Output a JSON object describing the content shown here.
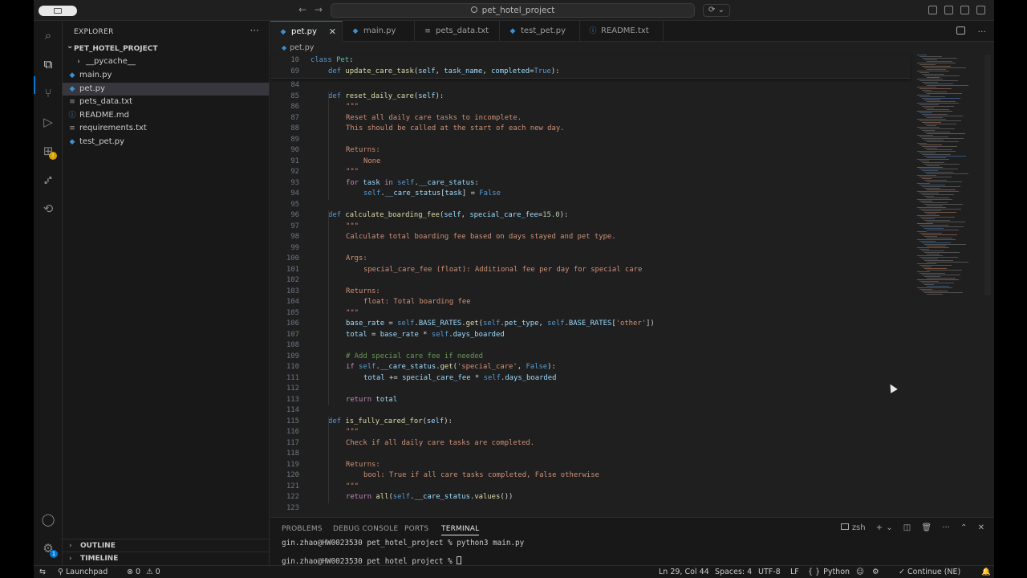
{
  "titlebar": {
    "search_text": "pet_hotel_project"
  },
  "sidebar": {
    "title": "EXPLORER",
    "project": "PET_HOTEL_PROJECT",
    "items": [
      {
        "label": "__pycache__",
        "icon": "›"
      },
      {
        "label": "main.py",
        "icon": "◆"
      },
      {
        "label": "pet.py",
        "icon": "◆"
      },
      {
        "label": "pets_data.txt",
        "icon": "≡"
      },
      {
        "label": "README.md",
        "icon": "ⓘ"
      },
      {
        "label": "requirements.txt",
        "icon": "≡"
      },
      {
        "label": "test_pet.py",
        "icon": "◆"
      }
    ],
    "outline": "OUTLINE",
    "timeline": "TIMELINE"
  },
  "tabs": [
    {
      "label": "pet.py",
      "icon": "◆"
    },
    {
      "label": "main.py",
      "icon": "◆"
    },
    {
      "label": "pets_data.txt",
      "icon": "≡"
    },
    {
      "label": "test_pet.py",
      "icon": "◆"
    },
    {
      "label": "README.txt",
      "icon": "ⓘ"
    }
  ],
  "breadcrumb": "pet.py",
  "sticky": [
    {
      "n": "10",
      "indent": 0,
      "tokens": [
        [
          "kw",
          "class "
        ],
        [
          "cls",
          "Pet"
        ],
        [
          "tx",
          ":"
        ]
      ]
    },
    {
      "n": "69",
      "indent": 1,
      "tokens": [
        [
          "kw",
          "def "
        ],
        [
          "fn",
          "update_care_task"
        ],
        [
          "tx",
          "("
        ],
        [
          "var",
          "self"
        ],
        [
          "tx",
          ", "
        ],
        [
          "var",
          "task_name"
        ],
        [
          "tx",
          ", "
        ],
        [
          "var",
          "completed"
        ],
        [
          "op",
          "="
        ],
        [
          "kw",
          "True"
        ],
        [
          "tx",
          "):"
        ]
      ]
    }
  ],
  "code": [
    {
      "n": "84",
      "indent": 0,
      "tokens": []
    },
    {
      "n": "85",
      "indent": 1,
      "tokens": [
        [
          "kw",
          "def "
        ],
        [
          "fn",
          "reset_daily_care"
        ],
        [
          "tx",
          "("
        ],
        [
          "var",
          "self"
        ],
        [
          "tx",
          "):"
        ]
      ]
    },
    {
      "n": "86",
      "indent": 2,
      "tokens": [
        [
          "doc",
          "\"\"\""
        ]
      ]
    },
    {
      "n": "87",
      "indent": 2,
      "tokens": [
        [
          "doc",
          "Reset all daily care tasks to incomplete."
        ]
      ]
    },
    {
      "n": "88",
      "indent": 2,
      "tokens": [
        [
          "doc",
          "This should be called at the start of each new day."
        ]
      ]
    },
    {
      "n": "89",
      "indent": 0,
      "tokens": []
    },
    {
      "n": "90",
      "indent": 2,
      "tokens": [
        [
          "doc",
          "Returns:"
        ]
      ]
    },
    {
      "n": "91",
      "indent": 3,
      "tokens": [
        [
          "doc",
          "None"
        ]
      ]
    },
    {
      "n": "92",
      "indent": 2,
      "tokens": [
        [
          "doc",
          "\"\"\""
        ]
      ]
    },
    {
      "n": "93",
      "indent": 2,
      "tokens": [
        [
          "kw2",
          "for "
        ],
        [
          "var",
          "task"
        ],
        [
          "kw2",
          " in "
        ],
        [
          "self",
          "self"
        ],
        [
          "tx",
          "."
        ],
        [
          "var",
          "__care_status"
        ],
        [
          "tx",
          ":"
        ]
      ]
    },
    {
      "n": "94",
      "indent": 3,
      "tokens": [
        [
          "self",
          "self"
        ],
        [
          "tx",
          "."
        ],
        [
          "var",
          "__care_status"
        ],
        [
          "tx",
          "["
        ],
        [
          "var",
          "task"
        ],
        [
          "tx",
          "] = "
        ],
        [
          "kw",
          "False"
        ]
      ]
    },
    {
      "n": "95",
      "indent": 0,
      "tokens": []
    },
    {
      "n": "96",
      "indent": 1,
      "tokens": [
        [
          "kw",
          "def "
        ],
        [
          "fn",
          "calculate_boarding_fee"
        ],
        [
          "tx",
          "("
        ],
        [
          "var",
          "self"
        ],
        [
          "tx",
          ", "
        ],
        [
          "var",
          "special_care_fee"
        ],
        [
          "op",
          "="
        ],
        [
          "num",
          "15.0"
        ],
        [
          "tx",
          "):"
        ]
      ]
    },
    {
      "n": "97",
      "indent": 2,
      "tokens": [
        [
          "doc",
          "\"\"\""
        ]
      ]
    },
    {
      "n": "98",
      "indent": 2,
      "tokens": [
        [
          "doc",
          "Calculate total boarding fee based on days stayed and pet type."
        ]
      ]
    },
    {
      "n": "99",
      "indent": 0,
      "tokens": []
    },
    {
      "n": "100",
      "indent": 2,
      "tokens": [
        [
          "doc",
          "Args:"
        ]
      ]
    },
    {
      "n": "101",
      "indent": 3,
      "tokens": [
        [
          "doc",
          "special_care_fee (float): Additional fee per day for special care"
        ]
      ]
    },
    {
      "n": "102",
      "indent": 0,
      "tokens": []
    },
    {
      "n": "103",
      "indent": 2,
      "tokens": [
        [
          "doc",
          "Returns:"
        ]
      ]
    },
    {
      "n": "104",
      "indent": 3,
      "tokens": [
        [
          "doc",
          "float: Total boarding fee"
        ]
      ]
    },
    {
      "n": "105",
      "indent": 2,
      "tokens": [
        [
          "doc",
          "\"\"\""
        ]
      ]
    },
    {
      "n": "106",
      "indent": 2,
      "tokens": [
        [
          "var",
          "base_rate"
        ],
        [
          "tx",
          " = "
        ],
        [
          "self",
          "self"
        ],
        [
          "tx",
          "."
        ],
        [
          "var",
          "BASE_RATES"
        ],
        [
          "tx",
          "."
        ],
        [
          "fn",
          "get"
        ],
        [
          "tx",
          "("
        ],
        [
          "self",
          "self"
        ],
        [
          "tx",
          "."
        ],
        [
          "var",
          "pet_type"
        ],
        [
          "tx",
          ", "
        ],
        [
          "self",
          "self"
        ],
        [
          "tx",
          "."
        ],
        [
          "var",
          "BASE_RATES"
        ],
        [
          "tx",
          "["
        ],
        [
          "str",
          "'other'"
        ],
        [
          "tx",
          "])"
        ]
      ]
    },
    {
      "n": "107",
      "indent": 2,
      "tokens": [
        [
          "var",
          "total"
        ],
        [
          "tx",
          " = "
        ],
        [
          "var",
          "base_rate"
        ],
        [
          "tx",
          " * "
        ],
        [
          "self",
          "self"
        ],
        [
          "tx",
          "."
        ],
        [
          "var",
          "days_boarded"
        ]
      ]
    },
    {
      "n": "108",
      "indent": 0,
      "tokens": []
    },
    {
      "n": "109",
      "indent": 2,
      "tokens": [
        [
          "cm",
          "# Add special care fee if needed"
        ]
      ]
    },
    {
      "n": "110",
      "indent": 2,
      "tokens": [
        [
          "kw2",
          "if "
        ],
        [
          "self",
          "self"
        ],
        [
          "tx",
          "."
        ],
        [
          "var",
          "__care_status"
        ],
        [
          "tx",
          "."
        ],
        [
          "fn",
          "get"
        ],
        [
          "tx",
          "("
        ],
        [
          "str",
          "'special_care'"
        ],
        [
          "tx",
          ", "
        ],
        [
          "kw",
          "False"
        ],
        [
          "tx",
          "):"
        ]
      ]
    },
    {
      "n": "111",
      "indent": 3,
      "tokens": [
        [
          "var",
          "total"
        ],
        [
          "tx",
          " += "
        ],
        [
          "var",
          "special_care_fee"
        ],
        [
          "tx",
          " * "
        ],
        [
          "self",
          "self"
        ],
        [
          "tx",
          "."
        ],
        [
          "var",
          "days_boarded"
        ]
      ]
    },
    {
      "n": "112",
      "indent": 0,
      "tokens": []
    },
    {
      "n": "113",
      "indent": 2,
      "tokens": [
        [
          "kw2",
          "return "
        ],
        [
          "var",
          "total"
        ]
      ]
    },
    {
      "n": "114",
      "indent": 0,
      "tokens": []
    },
    {
      "n": "115",
      "indent": 1,
      "tokens": [
        [
          "kw",
          "def "
        ],
        [
          "fn",
          "is_fully_cared_for"
        ],
        [
          "tx",
          "("
        ],
        [
          "var",
          "self"
        ],
        [
          "tx",
          "):"
        ]
      ]
    },
    {
      "n": "116",
      "indent": 2,
      "tokens": [
        [
          "doc",
          "\"\"\""
        ]
      ]
    },
    {
      "n": "117",
      "indent": 2,
      "tokens": [
        [
          "doc",
          "Check if all daily care tasks are completed."
        ]
      ]
    },
    {
      "n": "118",
      "indent": 0,
      "tokens": []
    },
    {
      "n": "119",
      "indent": 2,
      "tokens": [
        [
          "doc",
          "Returns:"
        ]
      ]
    },
    {
      "n": "120",
      "indent": 3,
      "tokens": [
        [
          "doc",
          "bool: True if all care tasks completed, False otherwise"
        ]
      ]
    },
    {
      "n": "121",
      "indent": 2,
      "tokens": [
        [
          "doc",
          "\"\"\""
        ]
      ]
    },
    {
      "n": "122",
      "indent": 2,
      "tokens": [
        [
          "kw2",
          "return "
        ],
        [
          "fn",
          "all"
        ],
        [
          "tx",
          "("
        ],
        [
          "self",
          "self"
        ],
        [
          "tx",
          "."
        ],
        [
          "var",
          "__care_status"
        ],
        [
          "tx",
          "."
        ],
        [
          "fn",
          "values"
        ],
        [
          "tx",
          "())"
        ]
      ]
    },
    {
      "n": "123",
      "indent": 0,
      "tokens": []
    }
  ],
  "panel": {
    "tabs": [
      "PROBLEMS",
      "DEBUG CONSOLE",
      "PORTS",
      "TERMINAL"
    ],
    "shell": "zsh",
    "terminal_lines": [
      "gin.zhao@HW0023530 pet_hotel_project % python3 main.py",
      "gin.zhao@HW0023530 pet_hotel_project % "
    ]
  },
  "status": {
    "launchpad": "Launchpad",
    "errors": "0",
    "warnings": "0",
    "position": "Ln 29, Col 44",
    "spaces": "Spaces: 4",
    "encoding": "UTF-8",
    "eol": "LF",
    "language": "Python",
    "language_braces": "{ }",
    "continue": "Continue (NE)"
  },
  "colors": {
    "accent": "#0078d4",
    "editor_bg": "#1f1f1f",
    "sidebar_bg": "#181818",
    "selection": "#37373d"
  }
}
